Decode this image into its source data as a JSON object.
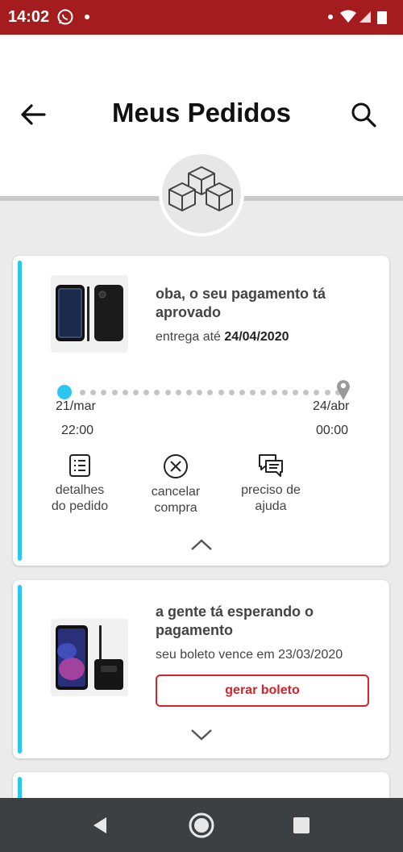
{
  "status_bar": {
    "time": "14:02"
  },
  "header": {
    "title": "Meus Pedidos"
  },
  "orders": [
    {
      "title_line1": "oba, o seu pagamento tá",
      "title_line2": "aprovado",
      "delivery_prefix": "entrega até ",
      "delivery_date": "24/04/2020",
      "progress": {
        "start_date": "21/mar",
        "start_time": "22:00",
        "end_date": "24/abr",
        "end_time": "00:00"
      },
      "actions": {
        "details": {
          "line1": "detalhes",
          "line2": "do pedido",
          "icon": "list-icon"
        },
        "cancel": {
          "line1": "cancelar",
          "line2": "compra",
          "icon": "cancel-circle-icon"
        },
        "help": {
          "line1": "preciso de",
          "line2": "ajuda",
          "icon": "chat-icon"
        }
      }
    },
    {
      "title_line1": "a gente tá esperando o",
      "title_line2": "pagamento",
      "due_text": "seu boleto vence em 23/03/2020",
      "button_label": "gerar boleto"
    }
  ],
  "colors": {
    "status_bar": "#a41c1e",
    "accent": "#2dc6f3",
    "button": "#d4232b"
  }
}
